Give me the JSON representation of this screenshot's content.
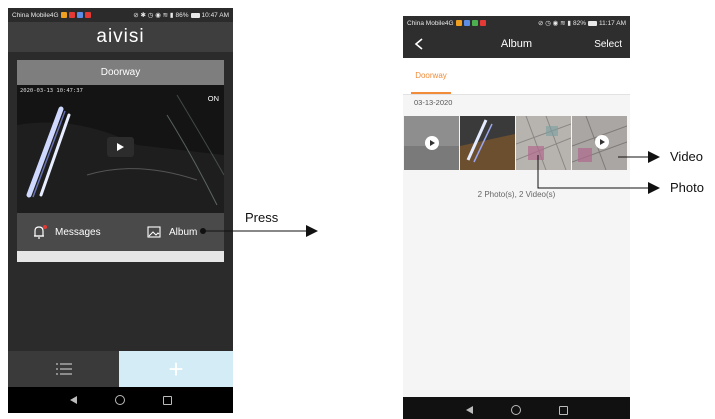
{
  "left_phone": {
    "status_bar": {
      "carrier": "China Mobile4G",
      "battery": "86%",
      "time": "10:47 AM"
    },
    "app_logo": "aivisi",
    "camera_card": {
      "title": "Doorway",
      "timestamp": "2020-03-13 10:47:37",
      "status": "ON",
      "messages_label": "Messages",
      "album_label": "Album"
    },
    "tabbar": {
      "add_label": "+"
    }
  },
  "right_phone": {
    "status_bar": {
      "carrier": "China Mobile4G",
      "battery": "82%",
      "time": "11:17 AM"
    },
    "header": {
      "title": "Album",
      "select_label": "Select"
    },
    "tab": "Doorway",
    "date": "03-13-2020",
    "thumbnails": [
      {
        "kind": "video"
      },
      {
        "kind": "photo"
      },
      {
        "kind": "photo"
      },
      {
        "kind": "video"
      }
    ],
    "count_text": "2 Photo(s), 2 Video(s)"
  },
  "annotations": {
    "press": "Press",
    "video": "Video",
    "photo": "Photo"
  },
  "colors": {
    "accent_orange": "#f08c3a",
    "add_tab_bg": "#d4ecf6",
    "badge_red": "#e53935"
  }
}
